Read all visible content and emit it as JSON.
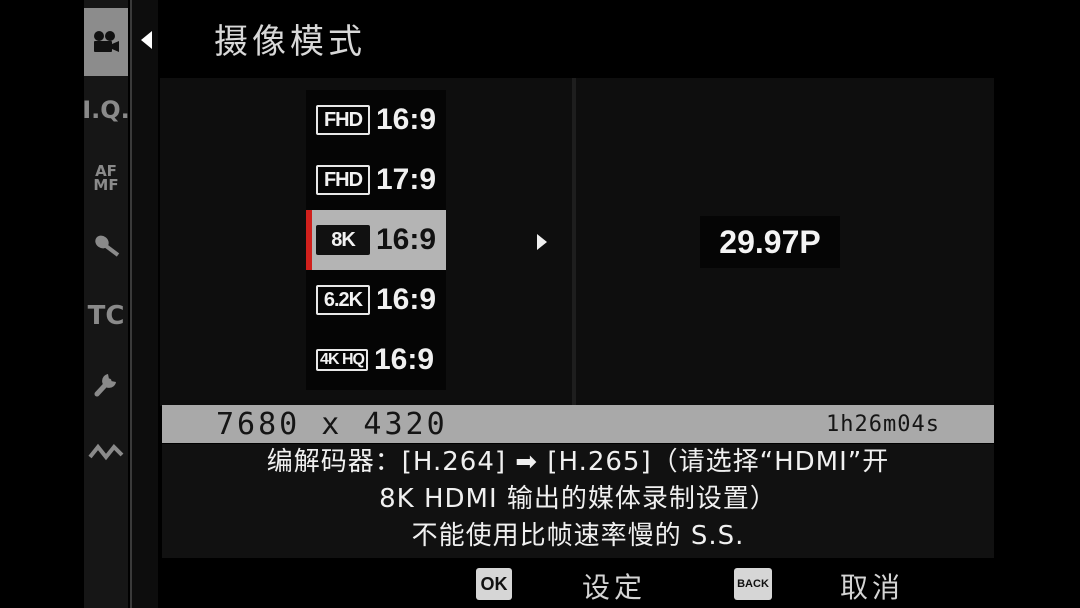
{
  "screen": {
    "title": "摄像模式",
    "accent_color": "#d0201c"
  },
  "tabs": [
    {
      "name": "movie-camera-icon",
      "label": "",
      "active": true
    },
    {
      "name": "iq-tab",
      "label": "I.Q."
    },
    {
      "name": "af-mf-tab",
      "label": "AF MF"
    },
    {
      "name": "microphone-icon",
      "label": ""
    },
    {
      "name": "tc-tab",
      "label": "TC"
    },
    {
      "name": "wrench-icon",
      "label": ""
    },
    {
      "name": "connection-icon",
      "label": ""
    }
  ],
  "mode_list": [
    {
      "badge": "FHD",
      "ratio": "16:9",
      "selected": false
    },
    {
      "badge": "FHD",
      "ratio": "17:9",
      "selected": false
    },
    {
      "badge": "8K",
      "ratio": "16:9",
      "selected": true
    },
    {
      "badge": "6.2K",
      "ratio": "16:9",
      "selected": false
    },
    {
      "badge": "4K HQ",
      "ratio": "16:9",
      "selected": false
    }
  ],
  "frame_rate": "29.97P",
  "info": {
    "resolution": "7680 x 4320",
    "record_time": "1h26m04s"
  },
  "message": {
    "line1": "编解码器：[H.264] ➡ [H.265]（请选择“HDMI”开",
    "line2": "8K HDMI 输出的媒体录制设置）",
    "line3": "不能使用比帧速率慢的 S.S."
  },
  "footer": {
    "ok_key": "OK",
    "ok_label": "设定",
    "back_key": "BACK",
    "back_label": "取消"
  }
}
